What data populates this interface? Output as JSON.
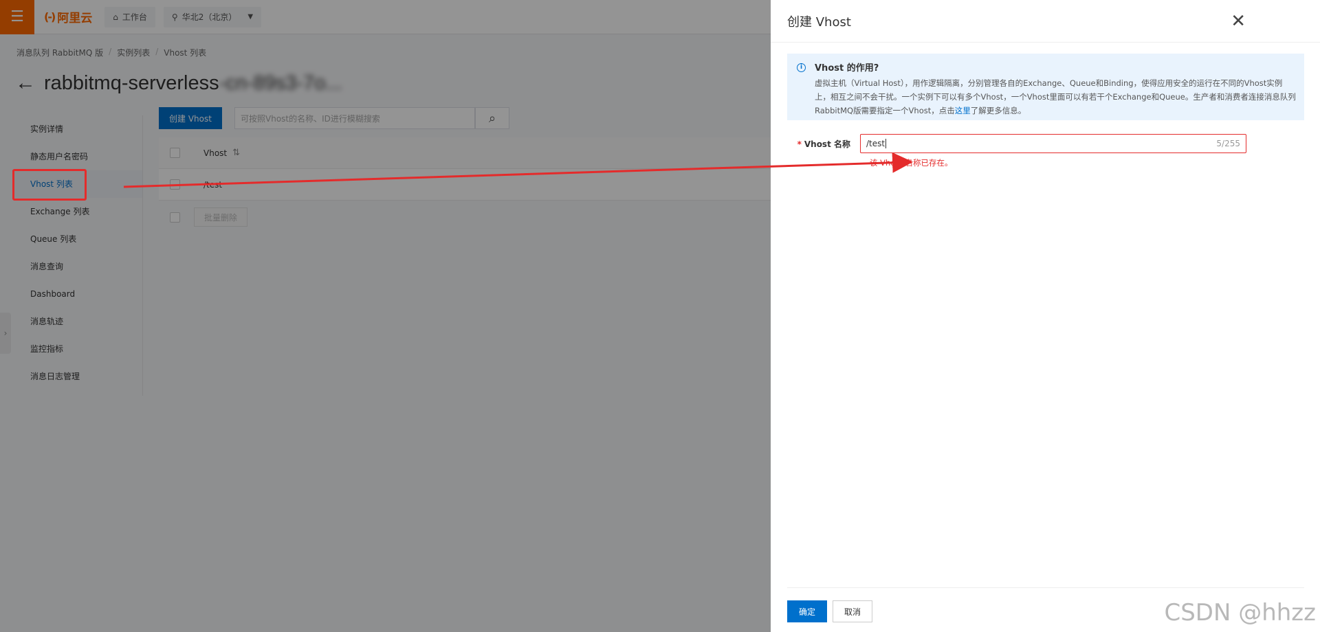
{
  "topbar": {
    "logo_mark": "(-)",
    "logo_text": "阿里云",
    "workbench_label": "工作台",
    "region_label": "华北2（北京）"
  },
  "breadcrumb": [
    "消息队列 RabbitMQ 版",
    "实例列表",
    "Vhost 列表"
  ],
  "page_title": {
    "prefix": "rabbitmq-serverless",
    "blurred": "-cn-89s3-7o...",
    "suffix": ""
  },
  "sidenav": {
    "items": [
      {
        "label": "实例详情",
        "active": false
      },
      {
        "label": "静态用户名密码",
        "active": false
      },
      {
        "label": "Vhost 列表",
        "active": true
      },
      {
        "label": "Exchange 列表",
        "active": false
      },
      {
        "label": "Queue 列表",
        "active": false
      },
      {
        "label": "消息查询",
        "active": false
      },
      {
        "label": "Dashboard",
        "active": false
      },
      {
        "label": "消息轨迹",
        "active": false
      },
      {
        "label": "监控指标",
        "active": false
      },
      {
        "label": "消息日志管理",
        "active": false
      }
    ]
  },
  "vhost_list": {
    "create_button": "创建 Vhost",
    "search_placeholder": "可按照Vhost的名称、ID进行模糊搜索",
    "column_header": "Vhost",
    "rows": [
      "/test"
    ],
    "batch_delete": "批量删除"
  },
  "drawer": {
    "title": "创建 Vhost",
    "notice_title": "Vhost 的作用?",
    "notice_body_1": "虚拟主机（Virtual Host），用作逻辑隔离，分别管理各自的Exchange、Queue和Binding，使得应用安全的运行在不同的Vhost实例上，相互之间不会干扰。一个实例下可以有多个Vhost，一个Vhost里面可以有若干个Exchange和Queue。生产者和消费者连接消息队列RabbitMQ版需要指定一个Vhost，点击",
    "notice_link": "这里",
    "notice_body_2": "了解更多信息。",
    "field_label": "Vhost 名称",
    "field_value": "/test",
    "field_count": "5/255",
    "field_error": "该 Vhost 名称已存在。",
    "ok_button": "确定",
    "cancel_button": "取消"
  },
  "watermark": "CSDN @hhzz",
  "colors": {
    "brand": "#ff6a00",
    "primary": "#0070cc",
    "error": "#e42b2b",
    "notice_bg": "#e9f3fd"
  }
}
